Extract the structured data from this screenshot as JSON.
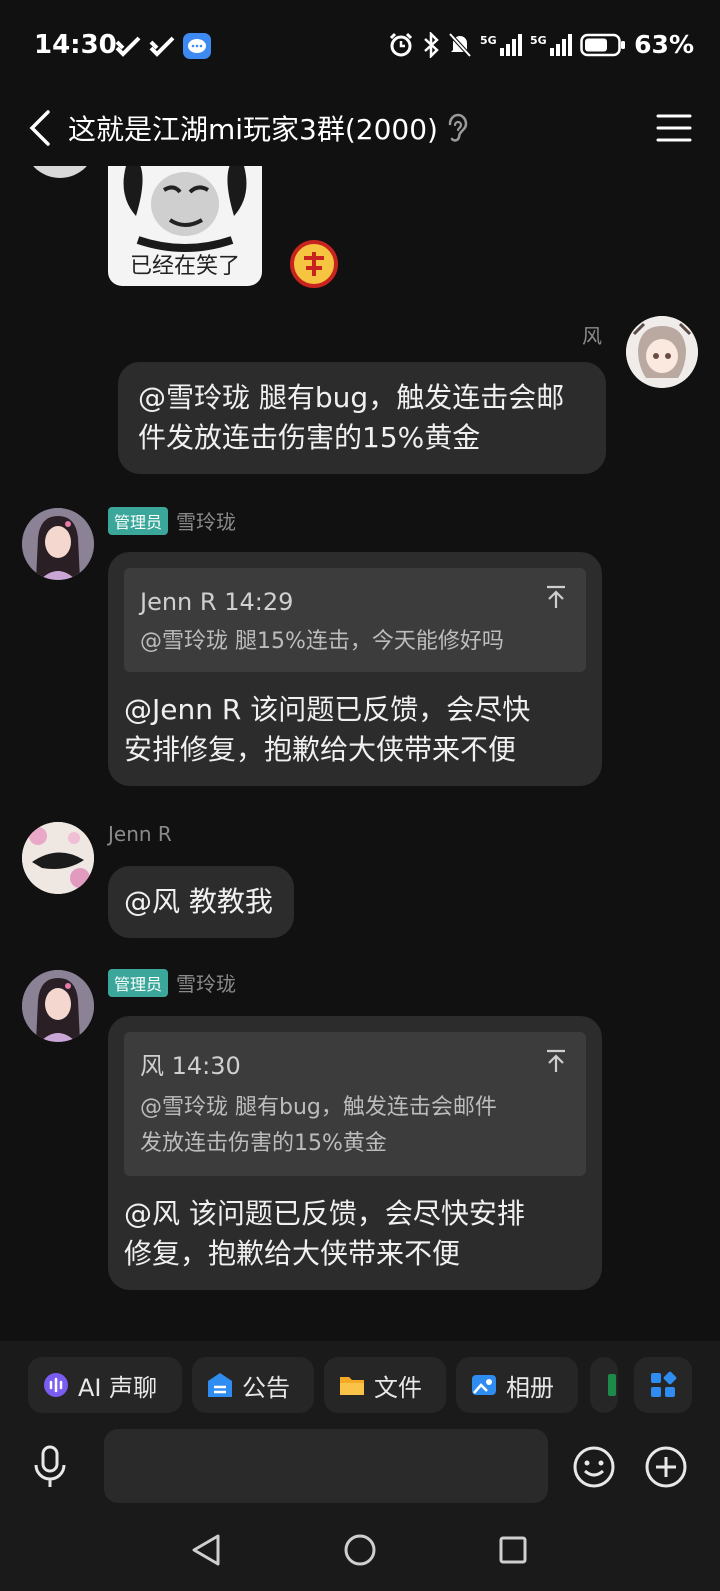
{
  "status_bar": {
    "time": "14:30",
    "signal1": "5G",
    "signal2": "5G",
    "battery": "63%"
  },
  "header": {
    "title": "这就是江湖mi玩家3群(2000)"
  },
  "messages": [
    {
      "type": "sticker",
      "sticker_text": "已经在笑了"
    },
    {
      "sender": "风",
      "text_line1": "@雪玲珑 腿有bug，触发连击会邮",
      "text_line2": "件发放连击伤害的15%黄金"
    },
    {
      "sender": "雪玲珑",
      "badge": "管理员",
      "quote_head": "Jenn R 14:29",
      "quote_body": "@雪玲珑 腿15%连击，今天能修好吗",
      "text_line1": "@Jenn R 该问题已反馈，会尽快",
      "text_line2": "安排修复，抱歉给大侠带来不便"
    },
    {
      "sender": "Jenn R",
      "text": "@风 教教我"
    },
    {
      "sender": "雪玲珑",
      "badge": "管理员",
      "quote_head": "风 14:30",
      "quote_body_line1": "@雪玲珑 腿有bug，触发连击会邮件",
      "quote_body_line2": "发放连击伤害的15%黄金",
      "text_line1": "@风  该问题已反馈，会尽快安排",
      "text_line2": "修复，抱歉给大侠带来不便"
    }
  ],
  "toolbar": {
    "ai_voice": "AI 声聊",
    "announcement": "公告",
    "files": "文件",
    "album": "相册"
  },
  "colors": {
    "background": "#111111",
    "bubble": "#2c2c2c",
    "badge": "#3aa79a"
  }
}
